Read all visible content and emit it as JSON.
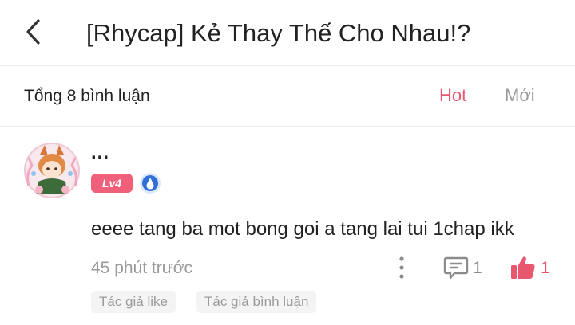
{
  "header": {
    "title": "[Rhycap] Kẻ Thay Thế Cho Nhau!?"
  },
  "comments_bar": {
    "total_label": "Tổng 8 bình luận",
    "sort_hot": "Hot",
    "sort_new": "Mới"
  },
  "comment": {
    "username": "...",
    "level": "Lv4",
    "text": "eeee tang ba mot bong goi a tang lai tui 1chap ikk",
    "time": "45 phút trước",
    "reply_count": "1",
    "like_count": "1",
    "tags": [
      "Tác giả like",
      "Tác giả bình luận"
    ]
  },
  "colors": {
    "accent": "#e9576f",
    "level_badge": "#f0607a",
    "rank_badge": "#2f6fd6",
    "muted": "#9a9a9a"
  },
  "icons": {
    "back": "chevron-left-icon",
    "more": "more-vertical-icon",
    "reply": "comment-icon",
    "like": "thumbs-up-icon",
    "rank": "rank-badge-icon"
  }
}
